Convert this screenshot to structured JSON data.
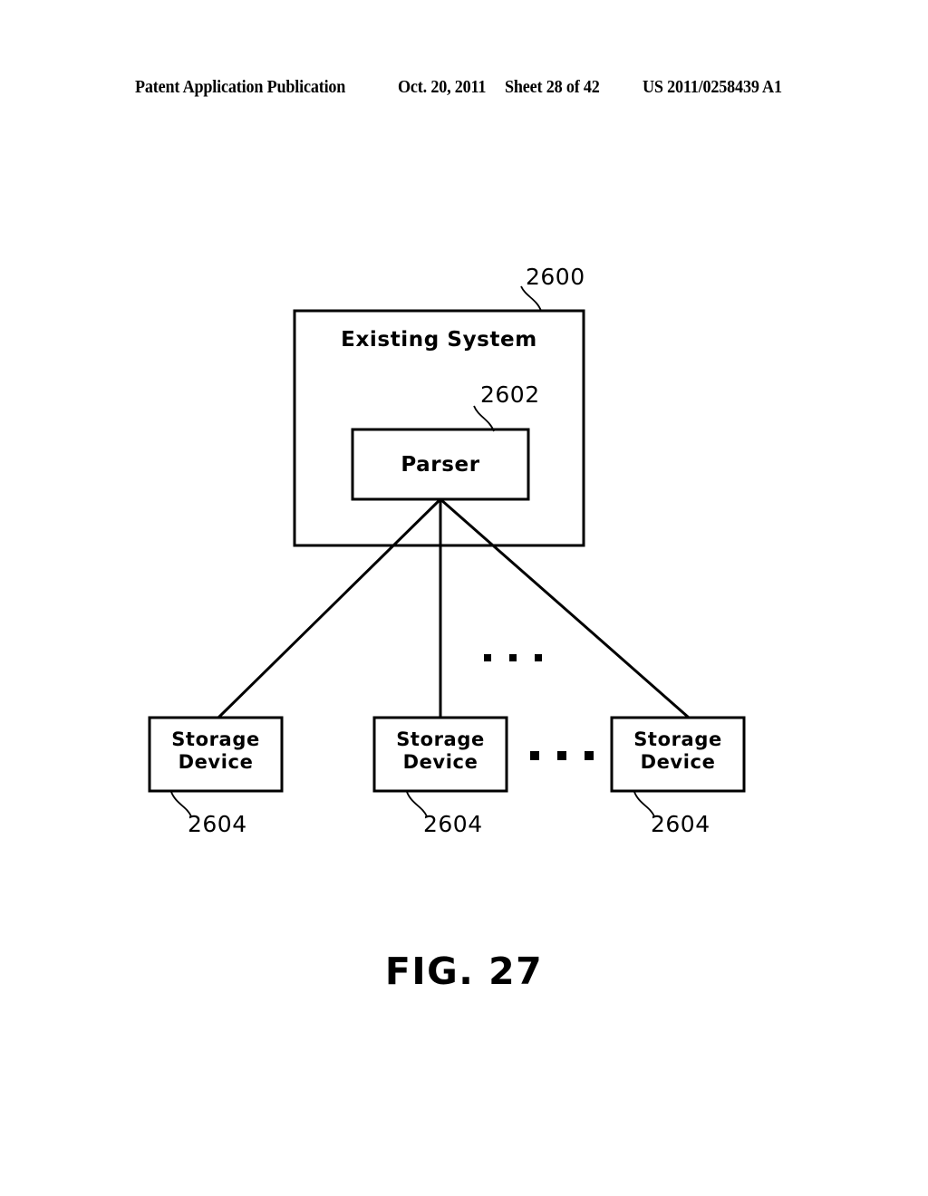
{
  "header": {
    "publication": "Patent Application Publication",
    "date": "Oct. 20, 2011",
    "sheet": "Sheet 28 of 42",
    "patent_number": "US 2011/0258439 A1"
  },
  "figure": {
    "caption": "FIG. 27",
    "ellipsis_upper": "• • •",
    "ellipsis_lower": "• • •"
  },
  "diagram": {
    "system_box": {
      "label": "Existing System",
      "ref": "2600"
    },
    "parser_box": {
      "label": "Parser",
      "ref": "2602"
    },
    "storage_devices": [
      {
        "line1": "Storage",
        "line2": "Device",
        "ref": "2604"
      },
      {
        "line1": "Storage",
        "line2": "Device",
        "ref": "2604"
      },
      {
        "line1": "Storage",
        "line2": "Device",
        "ref": "2604"
      }
    ]
  },
  "colors": {
    "ink": "#000000",
    "paper": "#ffffff"
  }
}
